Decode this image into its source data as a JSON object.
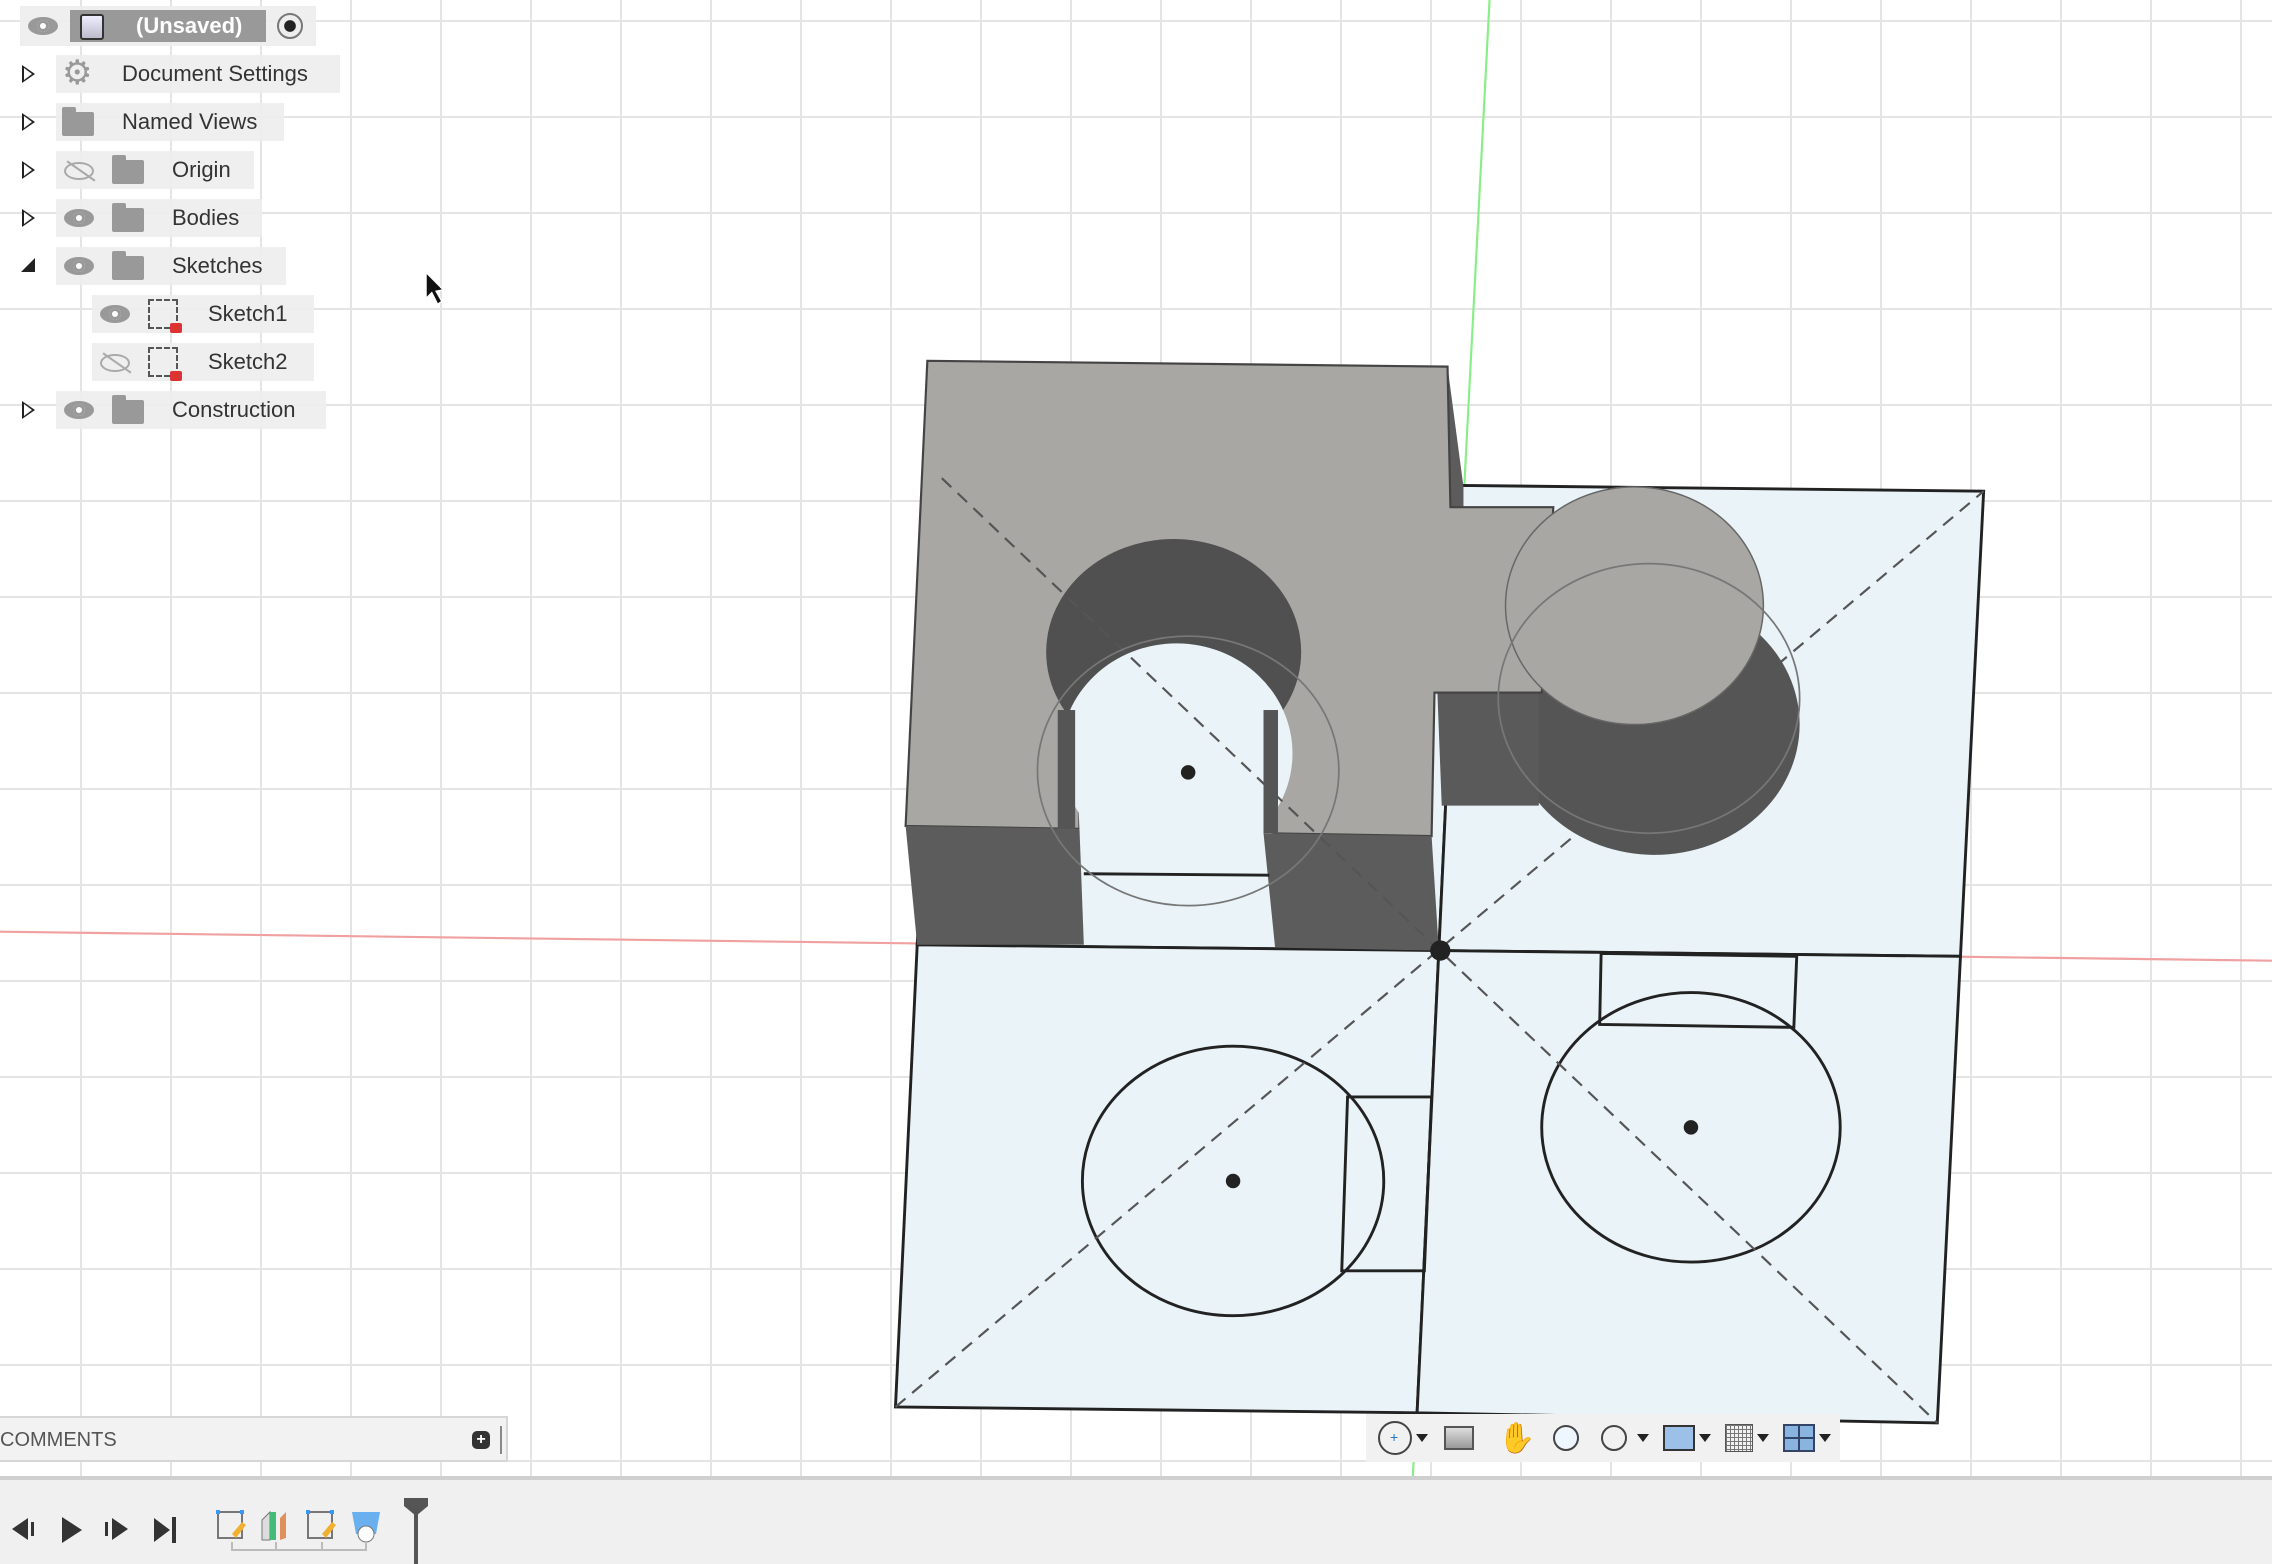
{
  "browser": {
    "root": {
      "label": "(Unsaved)",
      "visible": true,
      "icon": "component-cube-icon"
    },
    "items": [
      {
        "label": "Document Settings",
        "icon": "gear-icon",
        "expanded": false
      },
      {
        "label": "Named Views",
        "icon": "folder-icon",
        "expanded": false
      },
      {
        "label": "Origin",
        "icon": "folder-icon",
        "visible": false,
        "expanded": false
      },
      {
        "label": "Bodies",
        "icon": "folder-icon",
        "visible": true,
        "expanded": false
      },
      {
        "label": "Sketches",
        "icon": "folder-icon",
        "visible": true,
        "expanded": true
      },
      {
        "label": "Sketch1",
        "icon": "sketch-locked-icon",
        "visible": true
      },
      {
        "label": "Sketch2",
        "icon": "sketch-locked-icon",
        "visible": false
      },
      {
        "label": "Construction",
        "icon": "folder-icon",
        "visible": true,
        "expanded": false
      }
    ]
  },
  "comments": {
    "label": "COMMENTS",
    "add": "+"
  },
  "navbar": {
    "tools": [
      "orbit-icon",
      "look-at-icon",
      "pan-icon",
      "zoom-icon",
      "fit-icon",
      "display-settings-icon",
      "grid-icon",
      "viewports-icon"
    ]
  },
  "timeline": {
    "controls": [
      "step-back",
      "play",
      "step-forward",
      "go-to-end"
    ],
    "features": [
      "sketch",
      "extrude",
      "sketch",
      "hole"
    ]
  },
  "colors": {
    "body": "#a9a7a3",
    "body_dark": "#5c5c5c",
    "sketch_plane": "#eaf3f8",
    "x_axis": "#e88",
    "y_axis": "#7e7"
  }
}
